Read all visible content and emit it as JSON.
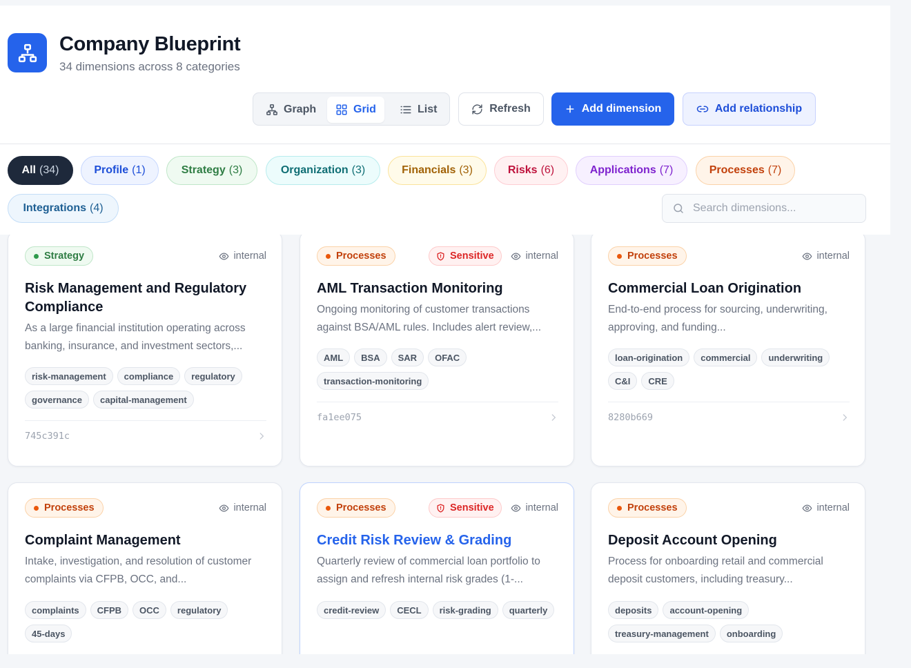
{
  "header": {
    "title": "Company Blueprint",
    "subtitle": "34 dimensions across 8 categories"
  },
  "view_toggle": {
    "graph": "Graph",
    "grid": "Grid",
    "list": "List",
    "active": "grid"
  },
  "actions": {
    "refresh": "Refresh",
    "add_dimension": "Add dimension",
    "add_relationship": "Add relationship"
  },
  "filters": [
    {
      "label": "All",
      "count": "(34)"
    },
    {
      "label": "Profile",
      "count": "(1)"
    },
    {
      "label": "Strategy",
      "count": "(3)"
    },
    {
      "label": "Organization",
      "count": "(3)"
    },
    {
      "label": "Financials",
      "count": "(3)"
    },
    {
      "label": "Risks",
      "count": "(6)"
    },
    {
      "label": "Applications",
      "count": "(7)"
    },
    {
      "label": "Processes",
      "count": "(7)"
    },
    {
      "label": "Integrations",
      "count": "(4)"
    }
  ],
  "search": {
    "placeholder": "Search dimensions...",
    "value": ""
  },
  "cards": [
    {
      "category": "Strategy",
      "sensitive": "",
      "visibility": "internal",
      "title": "Risk Management and Regulatory Compliance",
      "description": "As a large financial institution operating across banking, insurance, and investment sectors,...",
      "tags": [
        "risk-management",
        "compliance",
        "regulatory",
        "governance",
        "capital-management"
      ],
      "id": "745c391c"
    },
    {
      "category": "Processes",
      "sensitive": "Sensitive",
      "visibility": "internal",
      "title": "AML Transaction Monitoring",
      "description": "Ongoing monitoring of customer transactions against BSA/AML rules. Includes alert review,...",
      "tags": [
        "AML",
        "BSA",
        "SAR",
        "OFAC",
        "transaction-monitoring"
      ],
      "id": "fa1ee075"
    },
    {
      "category": "Processes",
      "sensitive": "",
      "visibility": "internal",
      "title": "Commercial Loan Origination",
      "description": "End-to-end process for sourcing, underwriting, approving, and funding...",
      "tags": [
        "loan-origination",
        "commercial",
        "underwriting",
        "C&I",
        "CRE"
      ],
      "id": "8280b669"
    },
    {
      "category": "Processes",
      "sensitive": "",
      "visibility": "internal",
      "title": "Complaint Management",
      "description": "Intake, investigation, and resolution of customer complaints via CFPB, OCC, and...",
      "tags": [
        "complaints",
        "CFPB",
        "OCC",
        "regulatory",
        "45-days"
      ],
      "id": ""
    },
    {
      "category": "Processes",
      "sensitive": "Sensitive",
      "visibility": "internal",
      "title": "Credit Risk Review & Grading",
      "description": "Quarterly review of commercial loan portfolio to assign and refresh internal risk grades (1-...",
      "tags": [
        "credit-review",
        "CECL",
        "risk-grading",
        "quarterly"
      ],
      "id": ""
    },
    {
      "category": "Processes",
      "sensitive": "",
      "visibility": "internal",
      "title": "Deposit Account Opening",
      "description": "Process for onboarding retail and commercial deposit customers, including treasury...",
      "tags": [
        "deposits",
        "account-opening",
        "treasury-management",
        "onboarding"
      ],
      "id": ""
    }
  ],
  "colors": {
    "primary": "#2563eb",
    "strategy": "#2f7d44",
    "processes": "#c2410c",
    "sensitive": "#dc2626",
    "all_chip": "#1e293b"
  }
}
